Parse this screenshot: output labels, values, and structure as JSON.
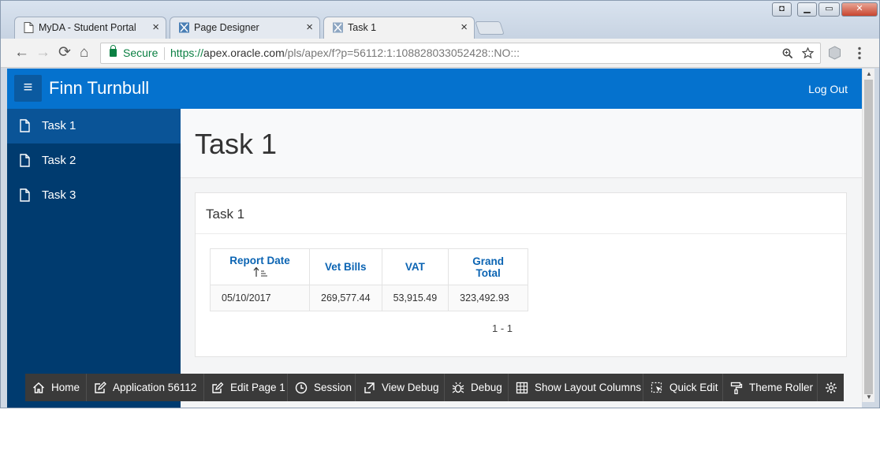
{
  "browser": {
    "tabs": [
      {
        "title": "MyDA - Student Portal",
        "active": false
      },
      {
        "title": "Page Designer",
        "active": false
      },
      {
        "title": "Task 1",
        "active": true
      }
    ],
    "close_glyph": "×",
    "secure_label": "Secure",
    "url_scheme": "https://",
    "url_host": "apex.oracle.com",
    "url_path": "/pls/apex/f?p=56112:1:108828033052428::NO:::",
    "nav": {
      "back": "←",
      "forward": "→",
      "reload": "⟳",
      "home": "⌂"
    },
    "window_buttons": {
      "restore": "◘",
      "minimize": "▁",
      "maximize": "▭",
      "close": "✕"
    }
  },
  "app": {
    "hamburger_glyph": "≡",
    "name": "Finn Turnbull",
    "logout_label": "Log Out",
    "accent_color": "#0572ce",
    "sidebar_color": "#003b6f"
  },
  "sidebar": {
    "items": [
      {
        "label": "Task 1",
        "active": true,
        "icon": "page-icon"
      },
      {
        "label": "Task 2",
        "active": false,
        "icon": "page-icon"
      },
      {
        "label": "Task 3",
        "active": false,
        "icon": "page-icon"
      }
    ]
  },
  "main": {
    "page_title": "Task 1",
    "region_title": "Task 1",
    "report": {
      "columns": [
        "Report Date",
        "Vet Bills",
        "VAT",
        "Grand Total"
      ],
      "sort_icon": "sort-ascending-icon",
      "rows": [
        [
          "05/10/2017",
          "269,577.44",
          "53,915.49",
          "323,492.93"
        ]
      ],
      "pagination": "1 - 1"
    }
  },
  "developer_toolbar": {
    "items": [
      {
        "label": "Home",
        "icon": "home-icon"
      },
      {
        "label": "Application 56112",
        "icon": "edit-app-icon"
      },
      {
        "label": "Edit Page 1",
        "icon": "edit-page-icon"
      },
      {
        "label": "Session",
        "icon": "clock-icon"
      },
      {
        "label": "View Debug",
        "icon": "view-debug-icon"
      },
      {
        "label": "Debug",
        "icon": "bug-icon"
      },
      {
        "label": "Show Layout Columns",
        "icon": "grid-icon"
      },
      {
        "label": "Quick Edit",
        "icon": "quick-edit-icon"
      },
      {
        "label": "Theme Roller",
        "icon": "paint-roller-icon"
      }
    ],
    "settings_icon": "gear-icon"
  }
}
